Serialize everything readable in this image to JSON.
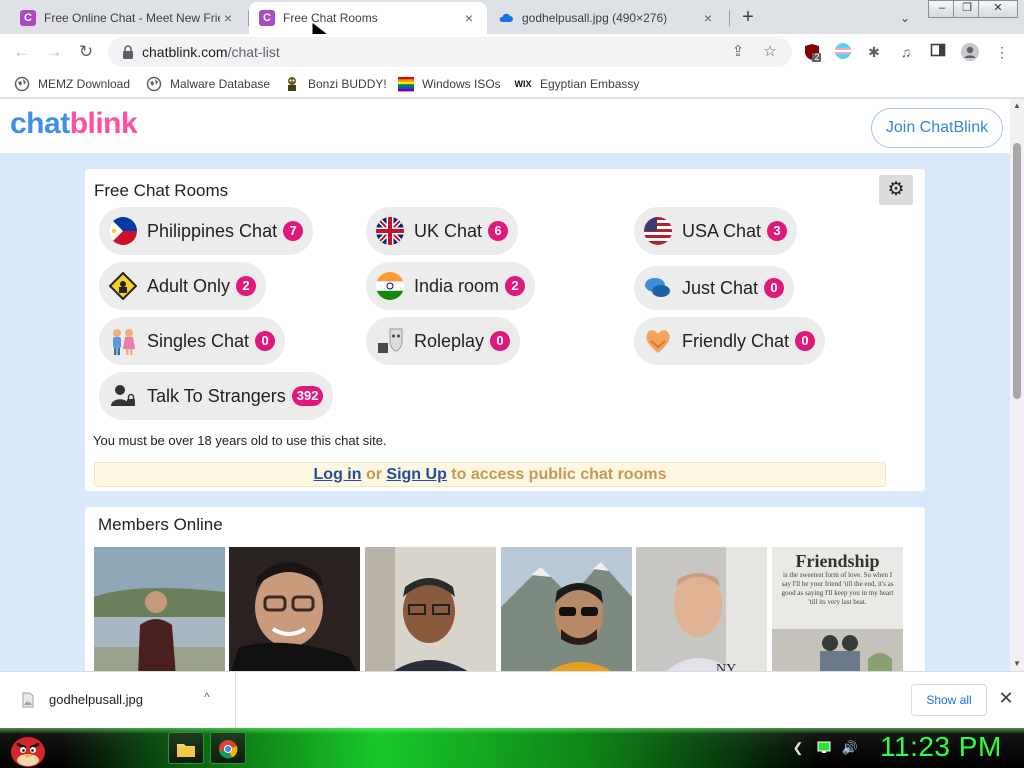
{
  "tabs": [
    {
      "title": "Free Online Chat - Meet New Frie",
      "favicon": "C",
      "active": false
    },
    {
      "title": "Free Chat Rooms",
      "favicon": "C",
      "active": true
    },
    {
      "title": "godhelpusall.jpg (490×276)",
      "favicon": "cloud",
      "active": false
    }
  ],
  "tabstrip": {
    "new_tab": "+",
    "tab_search": "⌄",
    "close": "×"
  },
  "window": {
    "minimize": "–",
    "maximize": "❐",
    "close": "✕"
  },
  "address": {
    "host": "chatblink.com",
    "path": "/chat-list"
  },
  "extensions": {
    "ublock_badge": "2"
  },
  "bookmarks": [
    {
      "label": "MEMZ Download",
      "icon": "globe-icon"
    },
    {
      "label": "Malware Database",
      "icon": "globe-icon"
    },
    {
      "label": "Bonzi BUDDY!",
      "icon": "bonzi-icon"
    },
    {
      "label": "Windows ISOs",
      "icon": "windows-icon"
    },
    {
      "label": "Egyptian Embassy",
      "icon": "wix-icon",
      "icon_text": "WIX"
    }
  ],
  "site": {
    "logo_part1": "chat",
    "logo_part2": "blink",
    "join_button": "Join ChatBlink",
    "rooms_heading": "Free Chat Rooms",
    "rooms": [
      {
        "name": "Philippines Chat",
        "count": "7",
        "icon": "philippines-flag-icon"
      },
      {
        "name": "UK Chat",
        "count": "6",
        "icon": "uk-flag-icon"
      },
      {
        "name": "USA Chat",
        "count": "3",
        "icon": "usa-flag-icon"
      },
      {
        "name": "Adult Only",
        "count": "2",
        "icon": "adult-sign-icon"
      },
      {
        "name": "India room",
        "count": "2",
        "icon": "india-flag-icon"
      },
      {
        "name": "Just Chat",
        "count": "0",
        "icon": "speech-bubbles-icon"
      },
      {
        "name": "Singles Chat",
        "count": "0",
        "icon": "couple-icon"
      },
      {
        "name": "Roleplay",
        "count": "0",
        "icon": "masks-icon"
      },
      {
        "name": "Friendly Chat",
        "count": "0",
        "icon": "heart-hands-icon"
      },
      {
        "name": "Talk To Strangers",
        "count": "392",
        "icon": "strangers-icon"
      }
    ],
    "age_notice": "You must be over 18 years old to use this chat site.",
    "login_prompt": {
      "login": "Log in",
      "or": "or",
      "signup": "Sign Up",
      "rest": "to access public chat rooms"
    },
    "members_heading": "Members Online",
    "members": [
      {
        "name": "member-photo-1"
      },
      {
        "name": "member-photo-2"
      },
      {
        "name": "member-photo-3"
      },
      {
        "name": "member-photo-4"
      },
      {
        "name": "member-photo-5"
      },
      {
        "name": "member-photo-6",
        "poster_title": "Friendship",
        "poster_text": "is the sweetest form of love. So when I say I'll be your friend 'till the end, it's as good as saying I'll keep you in my heart 'till its very last beat."
      }
    ]
  },
  "downloads": {
    "file": "godhelpusall.jpg",
    "show_all": "Show all",
    "menu": "^",
    "close": "✕"
  },
  "taskbar": {
    "clock": "11:23 PM"
  },
  "colors": {
    "brand_blue": "#3e8ef0",
    "brand_pink": "#ff4fa0",
    "count_badge": "#e0187c",
    "page_bg": "#d9e9fb",
    "clock_green": "#2cff3c"
  }
}
